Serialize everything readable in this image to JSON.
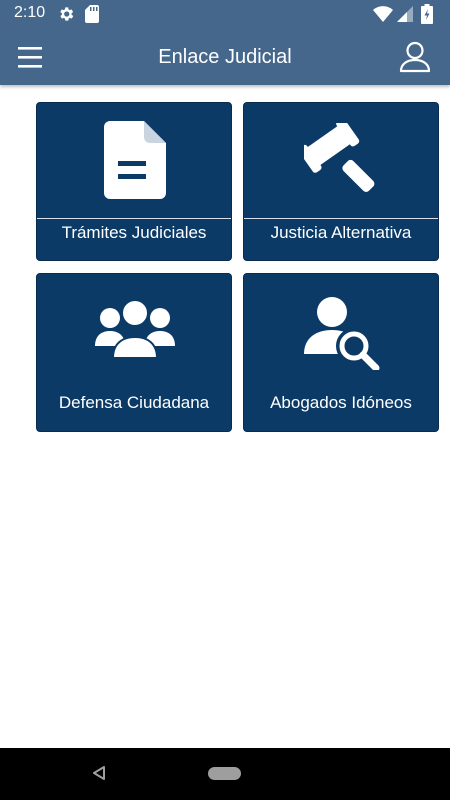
{
  "status_bar": {
    "time": "2:10",
    "icons": [
      "gear-icon",
      "sd-card-icon",
      "wifi-icon",
      "signal-icon",
      "battery-icon"
    ]
  },
  "app_bar": {
    "title": "Enlace Judicial",
    "menu_icon": "hamburger-menu-icon",
    "profile_icon": "user-profile-icon",
    "background": "#46678c"
  },
  "tiles": [
    {
      "label": "Trámites Judiciales",
      "icon": "document-icon"
    },
    {
      "label": "Justicia Alternativa",
      "icon": "gavel-icon"
    },
    {
      "label": "Defensa Ciudadana",
      "icon": "group-people-icon"
    },
    {
      "label": "Abogados Idóneos",
      "icon": "user-search-icon"
    }
  ],
  "colors": {
    "tile_background": "#0b3a67",
    "tile_text": "#ffffff",
    "icon_fill": "#ffffff"
  },
  "nav_bar": {
    "icons": [
      "back-icon",
      "home-pill-icon"
    ]
  }
}
